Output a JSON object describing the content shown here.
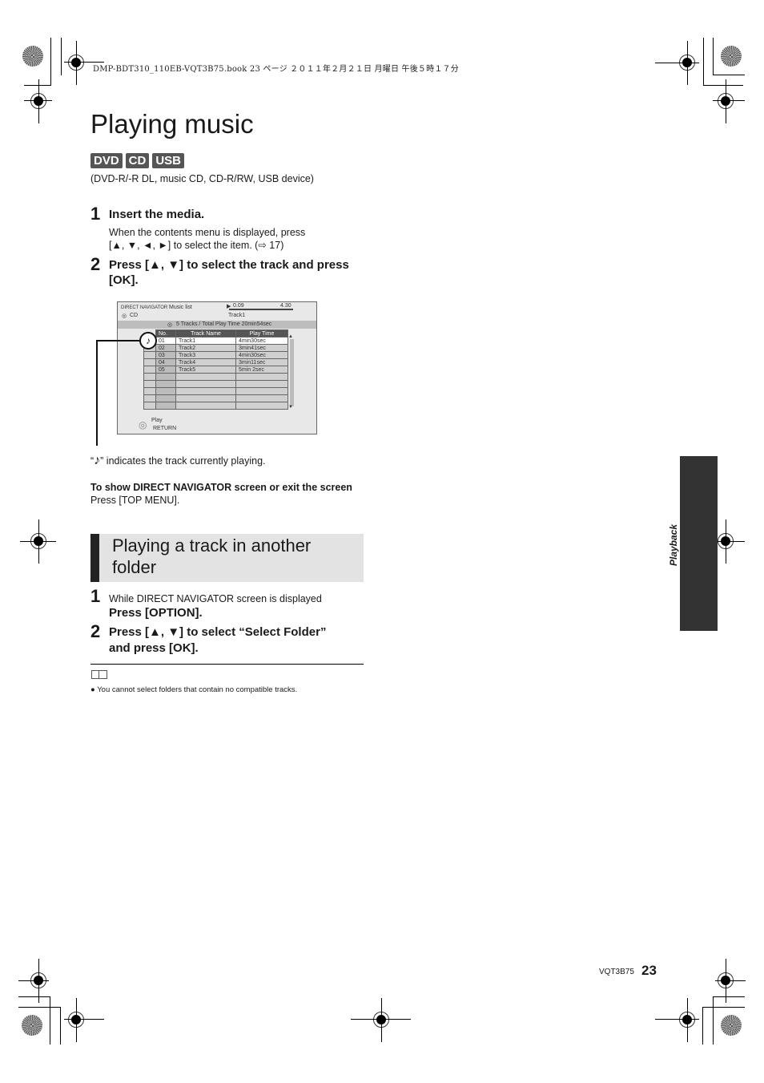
{
  "print_header": "DMP-BDT310_110EB-VQT3B75.book  23 ページ  ２０１１年２月２１日  月曜日  午後５時１７分",
  "page_title": "Playing music",
  "media_badges": [
    "DVD",
    "CD",
    "USB"
  ],
  "media_note": "(DVD-R/-R DL, music CD, CD-R/RW, USB device)",
  "steps": [
    {
      "num": "1",
      "title": "Insert the media.",
      "body_line1": "When the contents menu is displayed, press",
      "body_line2": "[▲, ▼, ◄, ►] to select the item. (⇨ 17)"
    },
    {
      "num": "2",
      "title_line1": "Press [▲, ▼] to select the track and press",
      "title_line2": "[OK]."
    }
  ],
  "screen": {
    "header_left": "DIRECT NAVIGATOR",
    "header_center": "Music list",
    "media_label": "CD",
    "media_icon": "disc-icon",
    "time_elapsed": "0.09",
    "time_total": "4.30",
    "progress_fraction": 1.0,
    "now_playing": "Track1",
    "summary": "5 Tracks / Total Play Time 20min54sec",
    "columns": [
      "No.",
      "Track Name",
      "Play Time"
    ],
    "tracks": [
      {
        "no": "01",
        "name": "Track1",
        "time": "4min30sec",
        "playing": true
      },
      {
        "no": "02",
        "name": "Track2",
        "time": "3min41sec",
        "playing": false
      },
      {
        "no": "03",
        "name": "Track3",
        "time": "4min30sec",
        "playing": false
      },
      {
        "no": "04",
        "name": "Track4",
        "time": "3min11sec",
        "playing": false
      },
      {
        "no": "05",
        "name": "Track5",
        "time": "5min  2sec",
        "playing": false
      }
    ],
    "footer_play": "Play",
    "footer_return": "RETURN",
    "playing_icon": "♪"
  },
  "playing_note_pre": "“",
  "playing_note_icon": "♪",
  "playing_note_post": "” indicates the track currently playing.",
  "direct_nav_heading": "To show DIRECT NAVIGATOR screen or exit the screen",
  "direct_nav_body": "Press [TOP MENU].",
  "section": {
    "title_line1": "Playing a track in another",
    "title_line2": "folder",
    "steps": [
      {
        "num": "1",
        "pre": "While DIRECT NAVIGATOR screen is displayed",
        "title": "Press [OPTION]."
      },
      {
        "num": "2",
        "title_line1": "Press [▲, ▼] to select “Select Folder”",
        "title_line2": "and press [OK]."
      }
    ]
  },
  "note_bullet": "You cannot select folders that contain no compatible tracks.",
  "side_tab_label": "Playback",
  "footer_code": "VQT3B75",
  "footer_page": "23"
}
